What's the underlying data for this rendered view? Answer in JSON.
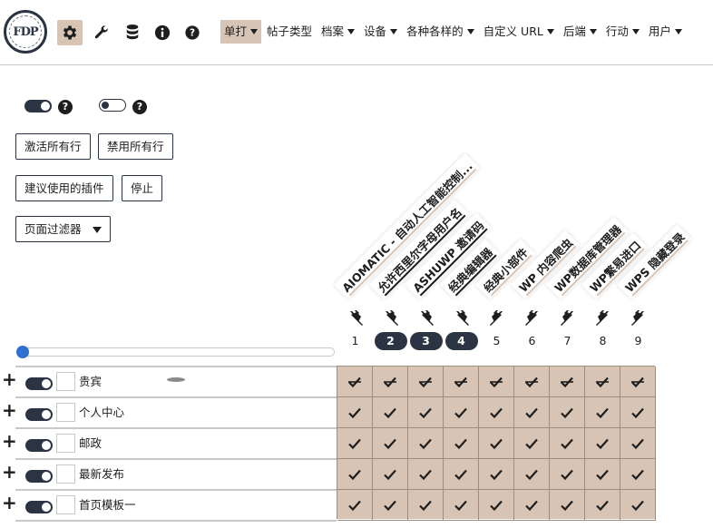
{
  "logo": {
    "text": "FDP"
  },
  "toolbar": {
    "icons": [
      "gear-icon",
      "wrench-icon",
      "database-icon",
      "info-icon",
      "help-icon"
    ]
  },
  "menu": [
    {
      "label": "单打",
      "dropdown": true,
      "active": true
    },
    {
      "label": "帖子类型",
      "dropdown": false,
      "active": false
    },
    {
      "label": "档案",
      "dropdown": true,
      "active": false
    },
    {
      "label": "设备",
      "dropdown": true,
      "active": false
    },
    {
      "label": "各种各样的",
      "dropdown": true,
      "active": false
    },
    {
      "label": "自定义 URL",
      "dropdown": true,
      "active": false
    },
    {
      "label": "后端",
      "dropdown": true,
      "active": false
    },
    {
      "label": "行动",
      "dropdown": true,
      "active": false
    },
    {
      "label": "用户",
      "dropdown": true,
      "active": false
    }
  ],
  "controls": {
    "activate_all": "激活所有行",
    "disable_all": "禁用所有行",
    "suggest_plugins": "建议使用的插件",
    "stop": "停止",
    "page_filter": "页面过滤器"
  },
  "plugins": [
    {
      "name": "AIOMATIC - 自动人工智能控制...",
      "num": "1",
      "highlight": false
    },
    {
      "name": "允许西里尔字母用户名",
      "num": "2",
      "highlight": true
    },
    {
      "name": "ASHUWP 邀请码",
      "num": "3",
      "highlight": true
    },
    {
      "name": "经典编辑器",
      "num": "4",
      "highlight": true
    },
    {
      "name": "经典小部件",
      "num": "5",
      "highlight": false
    },
    {
      "name": "WP 内容爬虫",
      "num": "6",
      "highlight": false
    },
    {
      "name": "WP数据库管理器",
      "num": "7",
      "highlight": false
    },
    {
      "name": "WP繁易进口",
      "num": "8",
      "highlight": false
    },
    {
      "name": "WPS 隐藏登录",
      "num": "9",
      "highlight": false
    }
  ],
  "rows": [
    {
      "name": "贵宾",
      "cells": "disabled-check"
    },
    {
      "name": "个人中心",
      "cells": "check"
    },
    {
      "name": "邮政",
      "cells": "check"
    },
    {
      "name": "最新发布",
      "cells": "check"
    },
    {
      "name": "首页模板一",
      "cells": "check"
    }
  ],
  "colors": {
    "accent": "#d7c4b4",
    "dark": "#2b3442",
    "slider": "#2f6fd0"
  }
}
